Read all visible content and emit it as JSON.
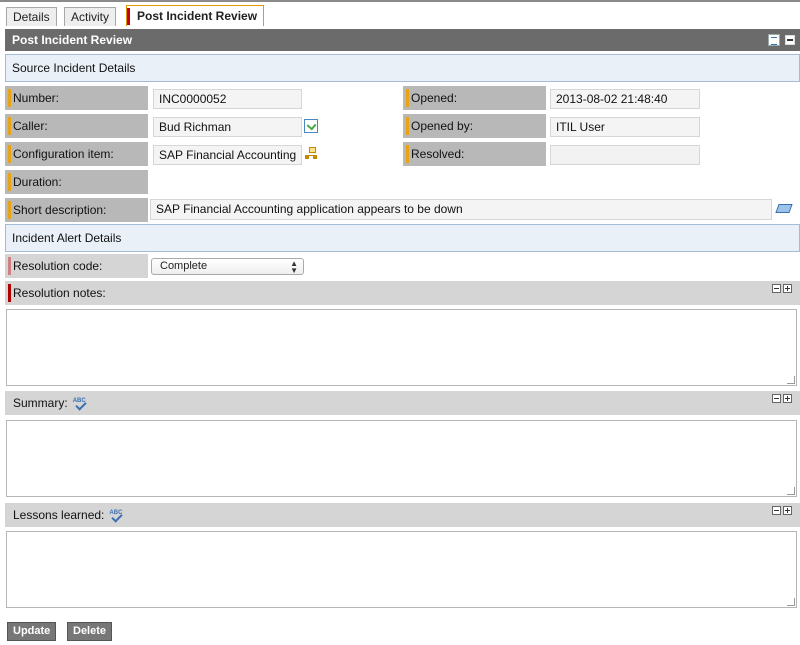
{
  "tabs": [
    {
      "label": "Details"
    },
    {
      "label": "Activity"
    },
    {
      "label": "Post Incident Review"
    }
  ],
  "form_title": "Post Incident Review",
  "source_section": "Source Incident Details",
  "fields": {
    "number": {
      "label": "Number:",
      "value": "INC0000052"
    },
    "caller": {
      "label": "Caller:",
      "value": "Bud Richman"
    },
    "ci": {
      "label": "Configuration item:",
      "value": "SAP Financial Accounting"
    },
    "duration": {
      "label": "Duration:"
    },
    "short_description": {
      "label": "Short description:",
      "value": "SAP Financial Accounting application appears to be down"
    },
    "opened": {
      "label": "Opened:",
      "value": "2013-08-02 21:48:40"
    },
    "opened_by": {
      "label": "Opened by:",
      "value": "ITIL User"
    },
    "resolved": {
      "label": "Resolved:",
      "value": ""
    }
  },
  "alert_section": "Incident Alert Details",
  "resolution_code": {
    "label": "Resolution code:",
    "value": "Complete"
  },
  "resolution_notes": {
    "label": "Resolution notes:",
    "value": ""
  },
  "summary": {
    "label": "Summary:",
    "value": ""
  },
  "lessons": {
    "label": "Lessons learned:",
    "value": ""
  },
  "spell_text": "ABC",
  "buttons": {
    "update": "Update",
    "delete": "Delete"
  },
  "colors": {
    "header": "#6b6b6b",
    "mandatory_mark": "#e8a317",
    "required_mark": "#b00000",
    "section_bg": "#eaf0f8"
  }
}
